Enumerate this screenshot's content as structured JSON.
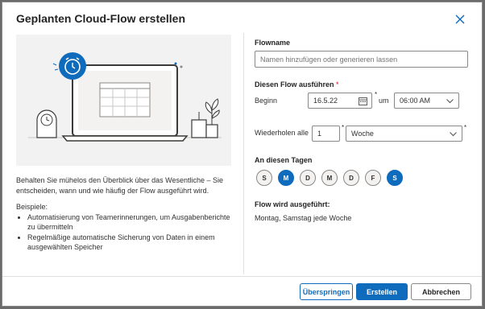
{
  "dialog": {
    "title": "Geplanten Cloud-Flow erstellen",
    "close_icon": "close-icon"
  },
  "illustration": {
    "icons": [
      "alarm-clock-icon",
      "laptop-icon",
      "calendar-grid-icon",
      "desk-clock-icon",
      "plant-icon"
    ],
    "accent_color": "#0f6cbd"
  },
  "description": {
    "intro": "Behalten Sie mühelos den Überblick über das Wesentliche – Sie entscheiden, wann und wie häufig der Flow ausgeführt wird.",
    "examples_label": "Beispiele:",
    "examples": [
      "Automatisierung von Teamerinnerungen, um Ausgabenberichte zu übermitteln",
      "Regelmäßige automatische Sicherung von Daten in einem ausgewählten Speicher"
    ]
  },
  "form": {
    "flowname_label": "Flowname",
    "flowname_placeholder": "Namen hinzufügen oder generieren lassen",
    "run_label": "Diesen Flow ausführen",
    "required_mark": "*",
    "start_label": "Beginn",
    "start_date": "16.5.22",
    "at_label": "um",
    "start_time": "06:00 AM",
    "repeat_label": "Wiederholen alle",
    "repeat_count": "1",
    "repeat_unit": "Woche",
    "days_label": "An diesen Tagen",
    "days": [
      {
        "label": "S",
        "selected": false
      },
      {
        "label": "M",
        "selected": true
      },
      {
        "label": "D",
        "selected": false
      },
      {
        "label": "M",
        "selected": false
      },
      {
        "label": "D",
        "selected": false
      },
      {
        "label": "F",
        "selected": false
      },
      {
        "label": "S",
        "selected": true
      }
    ],
    "summary_label": "Flow wird ausgeführt:",
    "summary_text": "Montag, Samstag jede Woche"
  },
  "footer": {
    "skip_label": "Überspringen",
    "create_label": "Erstellen",
    "cancel_label": "Abbrechen"
  },
  "colors": {
    "primary": "#0f6cbd",
    "required": "#c50f1f"
  }
}
